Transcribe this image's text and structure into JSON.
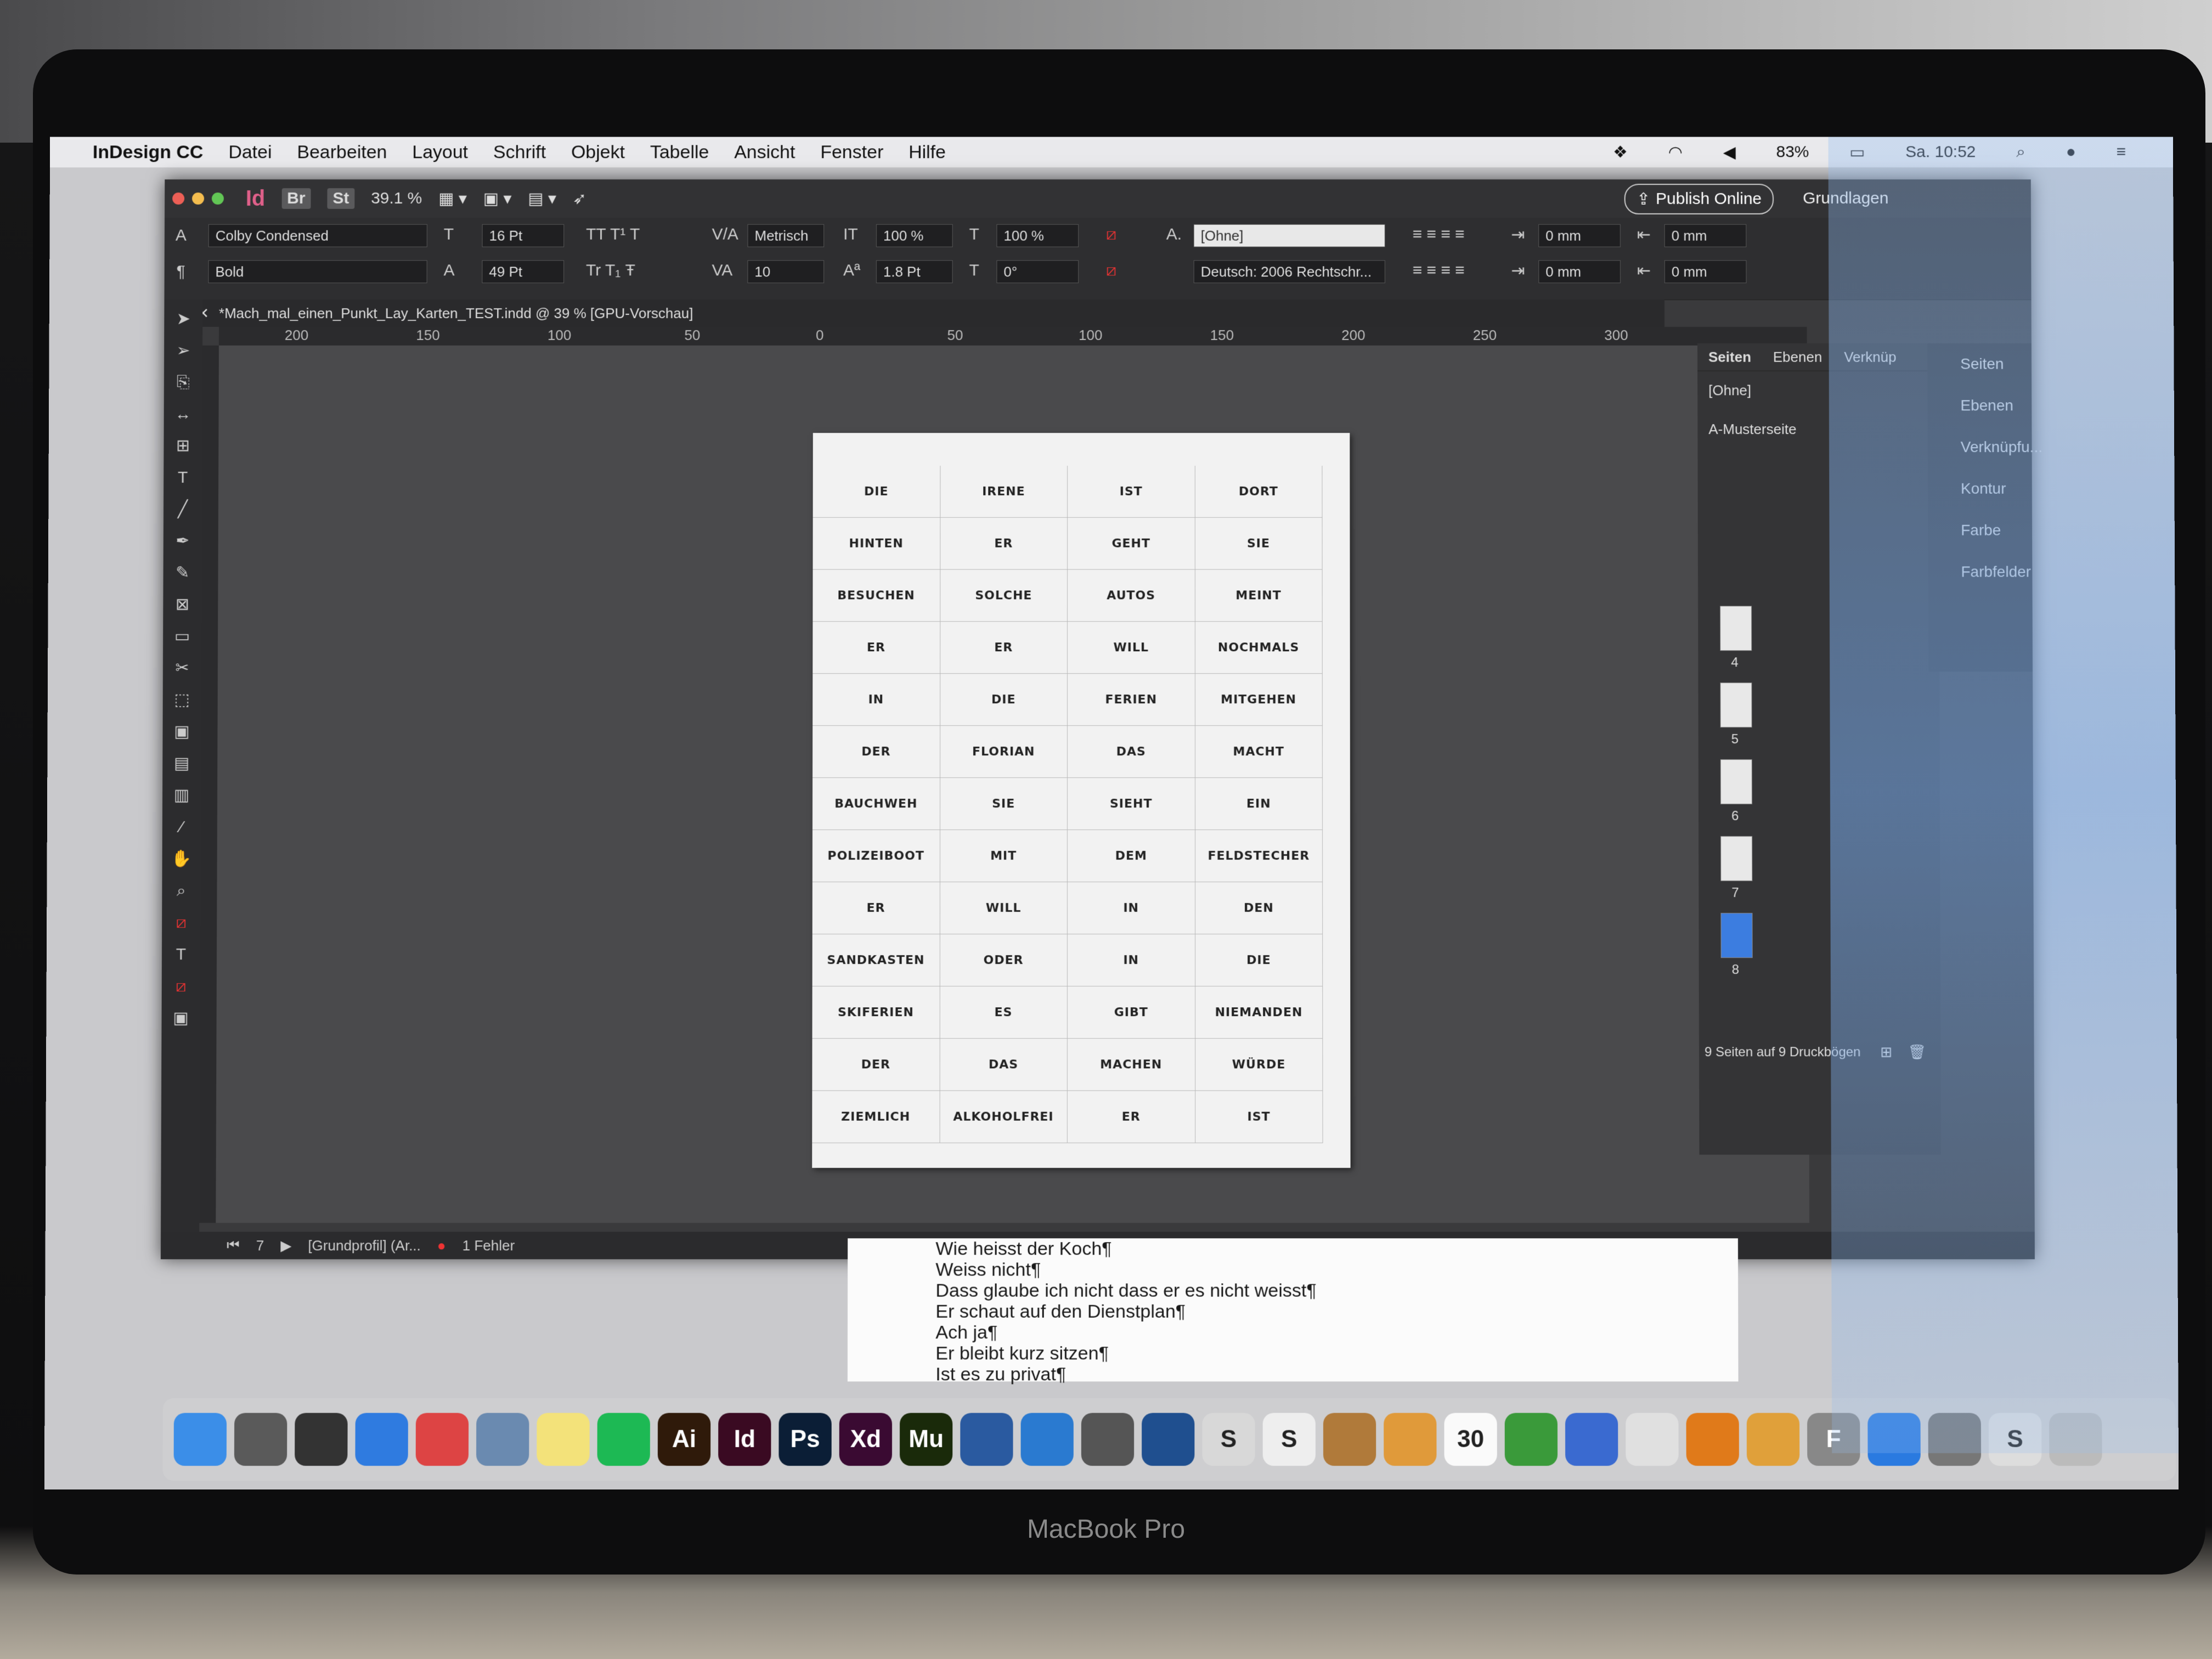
{
  "menubar": {
    "app": "InDesign CC",
    "items": [
      "Datei",
      "Bearbeiten",
      "Layout",
      "Schrift",
      "Objekt",
      "Tabelle",
      "Ansicht",
      "Fenster",
      "Hilfe"
    ],
    "battery": "83%",
    "clock": "Sa. 10:52"
  },
  "titlebar": {
    "br": "Br",
    "st": "St",
    "zoom": "39.1 %",
    "publish": "Publish Online",
    "workspace": "Grundlagen"
  },
  "control": {
    "font": "Colby Condensed",
    "style": "Bold",
    "size": "16 Pt",
    "leading": "49 Pt",
    "kerning": "Metrisch",
    "tracking": "10",
    "vscale": "100 %",
    "hscale": "100 %",
    "baseline": "1.8 Pt",
    "skew": "0°",
    "charstyle": "[Ohne]",
    "language": "Deutsch: 2006 Rechtschr...",
    "indent1": "0 mm",
    "indent2": "0 mm",
    "indent3": "0 mm",
    "indent4": "0 mm"
  },
  "document": {
    "tab": "*Mach_mal_einen_Punkt_Lay_Karten_TEST.indd @ 39 % [GPU-Vorschau]",
    "ruler": [
      "200",
      "150",
      "100",
      "50",
      "0",
      "50",
      "100",
      "150",
      "200",
      "250",
      "300"
    ],
    "cells": [
      "DIE",
      "IRENE",
      "IST",
      "DORT",
      "HINTEN",
      "ER",
      "GEHT",
      "SIE",
      "BESUCHEN",
      "SOLCHE",
      "AUTOS",
      "MEINT",
      "ER",
      "ER",
      "WILL",
      "NOCHMALS",
      "IN",
      "DIE",
      "FERIEN",
      "MITGEHEN",
      "DER",
      "FLORIAN",
      "DAS",
      "MACHT",
      "BAUCHWEH",
      "SIE",
      "SIEHT",
      "EIN",
      "POLIZEIBOOT",
      "MIT",
      "DEM",
      "FELDSTECHER",
      "ER",
      "WILL",
      "IN",
      "DEN",
      "SANDKASTEN",
      "ODER",
      "IN",
      "DIE",
      "SKIFERIEN",
      "ES",
      "GIBT",
      "NIEMANDEN",
      "DER",
      "DAS",
      "MACHEN",
      "WÜRDE",
      "ZIEMLICH",
      "ALKOHOLFREI",
      "ER",
      "IST"
    ]
  },
  "pages_panel": {
    "tabs": [
      "Seiten",
      "Ebenen",
      "Verknüp"
    ],
    "none": "[Ohne]",
    "master": "A-Musterseite",
    "pages": [
      "4",
      "5",
      "6",
      "7",
      "8"
    ],
    "footer": "9 Seiten auf 9 Druckbögen"
  },
  "side_panel": {
    "items": [
      "Seiten",
      "Ebenen",
      "Verknüpfu...",
      "Kontur",
      "Farbe",
      "Farbfelder"
    ]
  },
  "status": {
    "page": "7",
    "profile": "[Grundprofil] (Ar...",
    "errors": "1 Fehler"
  },
  "textdoc": {
    "lines": [
      "Wie heisst der Koch¶",
      "Weiss nicht¶",
      "Dass glaube ich nicht dass er es nicht weisst¶",
      "Er schaut auf den Dienstplan¶",
      "Ach ja¶",
      "Er bleibt kurz sitzen¶",
      "Ist es zu privat¶"
    ]
  },
  "dock": {
    "icons": [
      {
        "name": "finder-icon",
        "label": "",
        "color": "#3b8ee8"
      },
      {
        "name": "launchpad-icon",
        "label": "",
        "color": "#5a5a5a"
      },
      {
        "name": "app-icon",
        "label": "",
        "color": "#333"
      },
      {
        "name": "safari-icon",
        "label": "",
        "color": "#2f7be0"
      },
      {
        "name": "chrome-icon",
        "label": "",
        "color": "#d44"
      },
      {
        "name": "preview-icon",
        "label": "",
        "color": "#6a8ab0"
      },
      {
        "name": "notes-icon",
        "label": "",
        "color": "#f3e27a"
      },
      {
        "name": "spotify-icon",
        "label": "",
        "color": "#1db954"
      },
      {
        "name": "illustrator-icon",
        "label": "Ai",
        "color": "#2f1a0a"
      },
      {
        "name": "indesign-icon",
        "label": "Id",
        "color": "#3a0a22"
      },
      {
        "name": "photoshop-icon",
        "label": "Ps",
        "color": "#0b1e36"
      },
      {
        "name": "xd-icon",
        "label": "Xd",
        "color": "#3a0a32"
      },
      {
        "name": "muse-icon",
        "label": "Mu",
        "color": "#1a2a0a"
      },
      {
        "name": "app2-icon",
        "label": "",
        "color": "#2a5aa0"
      },
      {
        "name": "archiver-icon",
        "label": "",
        "color": "#2a7ad0"
      },
      {
        "name": "sequel-icon",
        "label": "",
        "color": "#555"
      },
      {
        "name": "sourcetree-icon",
        "label": "",
        "color": "#1f4f8f"
      },
      {
        "name": "slides-icon",
        "label": "S",
        "color": "#d8d8d8"
      },
      {
        "name": "scrivener-icon",
        "label": "S",
        "color": "#eee"
      },
      {
        "name": "notebook-icon",
        "label": "",
        "color": "#b07a3a"
      },
      {
        "name": "pages-icon",
        "label": "",
        "color": "#e09a3a"
      },
      {
        "name": "calendar-icon",
        "label": "30",
        "color": "#fafafa"
      },
      {
        "name": "numbers-icon",
        "label": "",
        "color": "#3a9a3a"
      },
      {
        "name": "keynote-icon",
        "label": "",
        "color": "#3a6ad0"
      },
      {
        "name": "itunes-icon",
        "label": "",
        "color": "#e0e0e0"
      },
      {
        "name": "books-icon",
        "label": "",
        "color": "#e07a1a"
      },
      {
        "name": "sketch-icon",
        "label": "",
        "color": "#e0a03a"
      },
      {
        "name": "fontbook-icon",
        "label": "F",
        "color": "#888"
      },
      {
        "name": "appstore-icon",
        "label": "",
        "color": "#2a7ae0"
      },
      {
        "name": "settings-icon",
        "label": "",
        "color": "#777"
      },
      {
        "name": "app3-icon",
        "label": "S",
        "color": "#ddd"
      },
      {
        "name": "trash-icon",
        "label": "",
        "color": "#bbb"
      }
    ]
  },
  "brand": "MacBook Pro"
}
